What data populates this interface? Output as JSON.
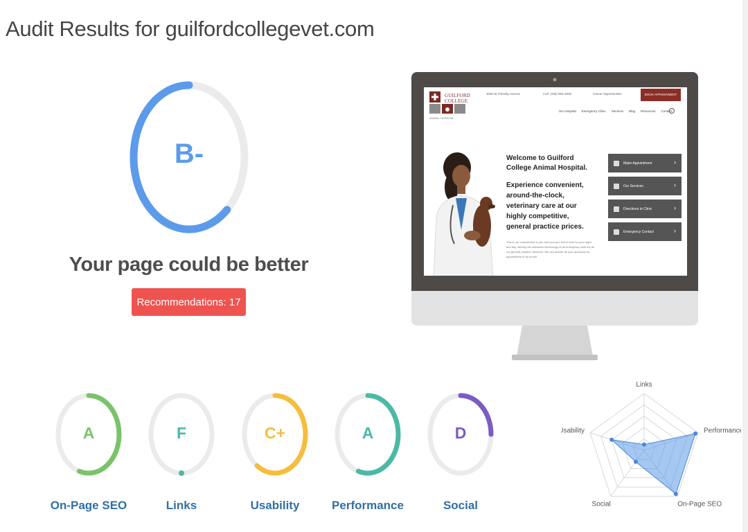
{
  "page": {
    "title": "Audit Results for guilfordcollegevet.com"
  },
  "overall": {
    "grade": "B-",
    "score_fraction": 0.62,
    "color": "#5b9bea",
    "headline": "Your page could be better"
  },
  "recommendations": {
    "label": "Recommendations: 17",
    "color": "#ef5350"
  },
  "preview": {
    "logo_name": "GUILFORD\nCOLLEGE",
    "logo_sub": "ANIMAL HOSPITAL",
    "address": "3000 W Friendly Avenue",
    "phone": "Call: (336) 852-2930",
    "careers": "Career Opportunities",
    "cta": "BOOK APPOINTMENT",
    "nav": [
      "Our Hospital",
      "Emergency Clinic",
      "Services",
      "Blog",
      "Resources",
      "Contact"
    ],
    "hero_title": "Welcome to Guilford College Animal Hospital.",
    "hero_subtitle": "Experience convenient, around-the-clock, veterinary care at our highly competitive, general practice prices.",
    "hero_body": "This is our commitment to you and your pet. We're here for your night and day, offering the advanced technology of an emergency clinic for all our general practice members. We can answer all your questions by appointment or by phone.",
    "menu": [
      "Make Appointment",
      "Our Services",
      "Directions to Clinic",
      "Emergency Contact"
    ]
  },
  "categories": [
    {
      "label": "On-Page SEO",
      "grade": "A",
      "color": "#7ac36a",
      "score_fraction": 0.55
    },
    {
      "label": "Links",
      "grade": "F",
      "color": "#4bb9a5",
      "score_fraction": 0.01
    },
    {
      "label": "Usability",
      "grade": "C+",
      "color": "#f6bd3c",
      "score_fraction": 0.6
    },
    {
      "label": "Performance",
      "grade": "A",
      "color": "#4bb9a5",
      "score_fraction": 0.55
    },
    {
      "label": "Social",
      "grade": "D",
      "color": "#7b5cc4",
      "score_fraction": 0.25
    }
  ],
  "radar": {
    "axes": [
      "Links",
      "Performance",
      "On-Page SEO",
      "Social",
      "Usability"
    ],
    "values": [
      0.1,
      0.95,
      0.95,
      0.25,
      0.6
    ],
    "color": "#5b9bea"
  }
}
